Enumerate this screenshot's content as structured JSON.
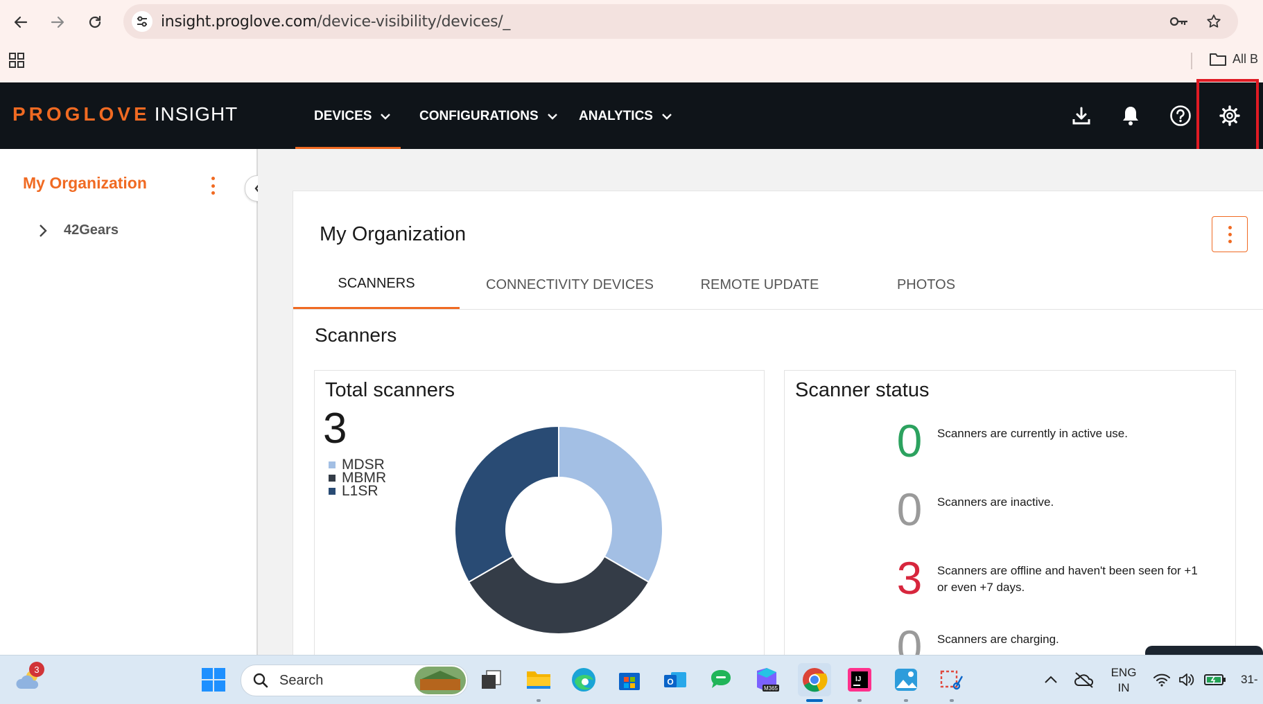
{
  "browser": {
    "url_host": "insight.proglove.com",
    "url_path": "/device-visibility/devices/_",
    "bookmarks_label": "All B"
  },
  "header": {
    "brand": "PROGLOVE",
    "product": "INSIGHT",
    "nav": [
      {
        "label": "DEVICES"
      },
      {
        "label": "CONFIGURATIONS"
      },
      {
        "label": "ANALYTICS"
      }
    ],
    "highlight_color": "#e01b24"
  },
  "sidebar": {
    "title": "My Organization",
    "items": [
      {
        "label": "42Gears"
      }
    ]
  },
  "main": {
    "title": "My Organization",
    "tabs": [
      {
        "label": "SCANNERS",
        "active": true
      },
      {
        "label": "CONNECTIVITY DEVICES"
      },
      {
        "label": "REMOTE UPDATE"
      },
      {
        "label": "PHOTOS"
      }
    ],
    "section_title": "Scanners",
    "total_panel": {
      "title": "Total scanners",
      "total": "3",
      "legend": [
        {
          "label": "MDSR",
          "color": "#a3bfe4"
        },
        {
          "label": "MBMR",
          "color": "#343c47"
        },
        {
          "label": "L1SR",
          "color": "#294b74"
        }
      ]
    },
    "status_panel": {
      "title": "Scanner status",
      "rows": [
        {
          "value": "0",
          "text": "Scanners are currently in active use.",
          "color": "#2ca25f"
        },
        {
          "value": "0",
          "text": "Scanners are inactive.",
          "color": "#9a9a9a"
        },
        {
          "value": "3",
          "text": "Scanners are offline and haven't been seen for +1 or even +7 days.",
          "color": "#d7263d"
        },
        {
          "value": "0",
          "text": "Scanners are charging.",
          "color": "#9a9a9a"
        }
      ]
    }
  },
  "chart_data": {
    "type": "pie",
    "categories": [
      "MDSR",
      "MBMR",
      "L1SR"
    ],
    "values": [
      1,
      1,
      1
    ],
    "colors": [
      "#a3bfe4",
      "#343c47",
      "#294b74"
    ],
    "donut": true
  },
  "taskbar": {
    "weather_badge": "3",
    "search_label": "Search",
    "lang_line1": "ENG",
    "lang_line2": "IN",
    "clock": "31-"
  },
  "colors": {
    "accent": "#f06a22",
    "header_bg": "#0f1419"
  }
}
